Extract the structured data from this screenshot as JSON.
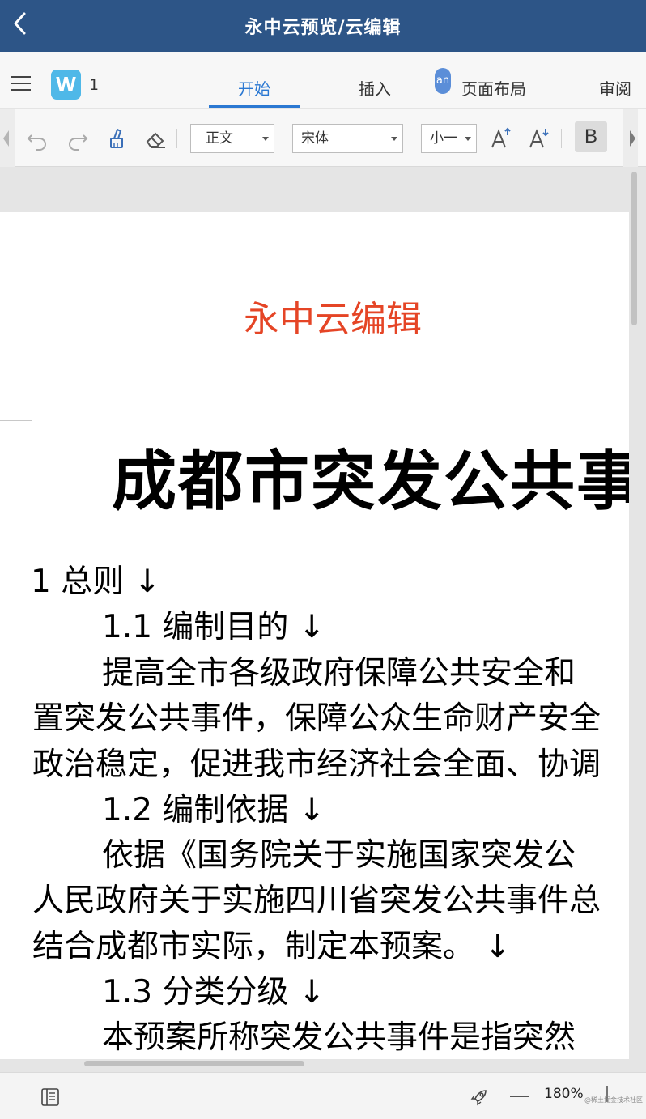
{
  "titlebar": {
    "title": "永中云预览/云编辑"
  },
  "tabbar": {
    "doc_name": "1",
    "doc_icon_letter": "W",
    "avatar_text": "an",
    "tabs": [
      {
        "label": "开始",
        "active": true
      },
      {
        "label": "插入",
        "active": false
      },
      {
        "label": "页面布局",
        "active": false
      },
      {
        "label": "审阅",
        "active": false
      }
    ]
  },
  "toolbar": {
    "style_value": "正文",
    "font_value": "宋体",
    "size_value": "小一",
    "bold_label": "B"
  },
  "document": {
    "header": "永中云编辑",
    "title": "成都市突发公共事",
    "lines": [
      "1  总则 ↓",
      "1.1  编制目的 ↓",
      "提高全市各级政府保障公共安全和",
      "置突发公共事件，保障公众生命财产安全",
      "政治稳定，促进我市经济社会全面、协调",
      "1.2  编制依据 ↓",
      "依据《国务院关于实施国家突发公",
      "人民政府关于实施四川省突发公共事件总",
      "结合成都市实际，制定本预案。  ↓",
      "1.3  分类分级 ↓",
      "本预案所称突发公共事件是指突然"
    ]
  },
  "statusbar": {
    "zoom": "180%",
    "watermark": "@稀土掘金技术社区"
  }
}
